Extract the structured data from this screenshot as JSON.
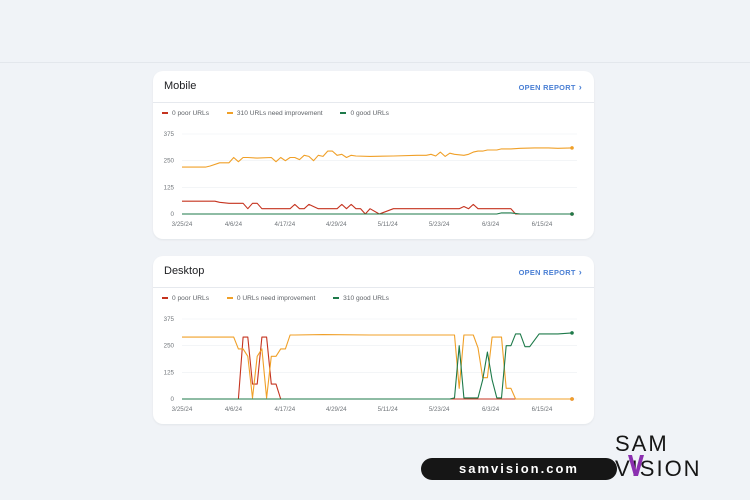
{
  "colors": {
    "poor": "#c5331f",
    "improve": "#f0a028",
    "good": "#1e7a4a",
    "link": "#4a7fd4"
  },
  "mobile": {
    "title": "Mobile",
    "open_report": "OPEN REPORT",
    "legend": {
      "poor": "0 poor URLs",
      "improve": "310 URLs need improvement",
      "good": "0 good URLs"
    }
  },
  "desktop": {
    "title": "Desktop",
    "open_report": "OPEN REPORT",
    "legend": {
      "poor": "0 poor URLs",
      "improve": "0 URLs need improvement",
      "good": "310 good URLs"
    }
  },
  "chart_data": [
    {
      "type": "line",
      "ylim": [
        0,
        375
      ],
      "yticks": [
        0,
        125,
        250,
        375
      ],
      "xticks": [
        "3/25/24",
        "4/6/24",
        "4/17/24",
        "4/29/24",
        "5/11/24",
        "5/23/24",
        "6/3/24",
        "6/15/24"
      ],
      "x_range": [
        0,
        83
      ],
      "series": [
        {
          "name": "0 poor URLs",
          "color": "#c5331f",
          "x": [
            0,
            7,
            8,
            10,
            13,
            14,
            15,
            16,
            17,
            19,
            22,
            23,
            24,
            25,
            26,
            27,
            29,
            30,
            31,
            32,
            33,
            34,
            35,
            36,
            37,
            38,
            39,
            40,
            42,
            45,
            50,
            55,
            57,
            58,
            59,
            60,
            61,
            62,
            63,
            64,
            65,
            66,
            70,
            71,
            75,
            80,
            83
          ],
          "values": [
            60,
            60,
            55,
            50,
            50,
            25,
            50,
            50,
            25,
            25,
            25,
            25,
            45,
            25,
            25,
            45,
            25,
            25,
            25,
            25,
            25,
            45,
            25,
            45,
            25,
            25,
            0,
            25,
            0,
            25,
            25,
            25,
            25,
            25,
            25,
            35,
            25,
            45,
            25,
            25,
            25,
            25,
            25,
            0,
            0,
            0,
            0
          ]
        },
        {
          "name": "310 URLs need improvement",
          "color": "#f0a028",
          "x": [
            0,
            5,
            6,
            8,
            10,
            11,
            12,
            13,
            14,
            16,
            19,
            20,
            21,
            22,
            23,
            24,
            25,
            26,
            27,
            28,
            29,
            30,
            31,
            32,
            33,
            34,
            35,
            36,
            37,
            40,
            45,
            50,
            52,
            53,
            54,
            55,
            56,
            57,
            58,
            60,
            61,
            62,
            63,
            64,
            65,
            66,
            67,
            68,
            70,
            72,
            75,
            78,
            80,
            83
          ],
          "values": [
            220,
            220,
            225,
            240,
            240,
            265,
            245,
            265,
            265,
            262,
            265,
            245,
            265,
            250,
            265,
            265,
            255,
            275,
            270,
            250,
            275,
            270,
            295,
            295,
            275,
            280,
            265,
            275,
            272,
            270,
            272,
            275,
            275,
            280,
            272,
            290,
            270,
            285,
            280,
            275,
            280,
            290,
            295,
            295,
            300,
            300,
            300,
            305,
            305,
            308,
            310,
            310,
            308,
            310
          ]
        },
        {
          "name": "0 good URLs",
          "color": "#1e7a4a",
          "x": [
            0,
            62,
            66,
            67,
            68,
            70,
            72,
            75,
            80,
            83
          ],
          "values": [
            0,
            0,
            0,
            0,
            5,
            5,
            0,
            0,
            0,
            0
          ]
        }
      ]
    },
    {
      "type": "line",
      "ylim": [
        0,
        375
      ],
      "yticks": [
        0,
        125,
        250,
        375
      ],
      "xticks": [
        "3/25/24",
        "4/6/24",
        "4/17/24",
        "4/29/24",
        "5/11/24",
        "5/23/24",
        "6/3/24",
        "6/15/24"
      ],
      "x_range": [
        0,
        83
      ],
      "series": [
        {
          "name": "0 poor URLs",
          "color": "#c5331f",
          "x": [
            0,
            12,
            13,
            14,
            15,
            16,
            17,
            18,
            19,
            20,
            21,
            22,
            83
          ],
          "values": [
            0,
            0,
            290,
            290,
            70,
            70,
            290,
            290,
            70,
            70,
            0,
            0,
            0
          ]
        },
        {
          "name": "0 URLs need improvement",
          "color": "#f0a028",
          "x": [
            0,
            11,
            12,
            13,
            14,
            15,
            16,
            17,
            18,
            19,
            20,
            21,
            22,
            23,
            24,
            30,
            40,
            50,
            55,
            57,
            58,
            59,
            60,
            61,
            62,
            63,
            64,
            65,
            66,
            67,
            68,
            69,
            70,
            71,
            72,
            73,
            74,
            83
          ],
          "values": [
            290,
            290,
            235,
            235,
            200,
            5,
            200,
            235,
            5,
            200,
            200,
            235,
            235,
            300,
            300,
            302,
            300,
            300,
            300,
            300,
            300,
            50,
            300,
            300,
            300,
            240,
            100,
            100,
            290,
            290,
            290,
            50,
            50,
            0,
            0,
            0,
            0,
            0
          ]
        },
        {
          "name": "310 good URLs",
          "color": "#1e7a4a",
          "x": [
            0,
            57,
            58,
            59,
            60,
            61,
            62,
            63,
            64,
            65,
            66,
            67,
            68,
            69,
            70,
            71,
            72,
            73,
            74,
            76,
            80,
            83
          ],
          "values": [
            0,
            0,
            5,
            250,
            5,
            5,
            5,
            5,
            90,
            220,
            90,
            5,
            5,
            250,
            250,
            305,
            305,
            245,
            245,
            305,
            305,
            310
          ]
        }
      ]
    }
  ],
  "brand": {
    "url": "samvision.com",
    "logo_top": "SAM",
    "logo_bottom": "VISION"
  }
}
